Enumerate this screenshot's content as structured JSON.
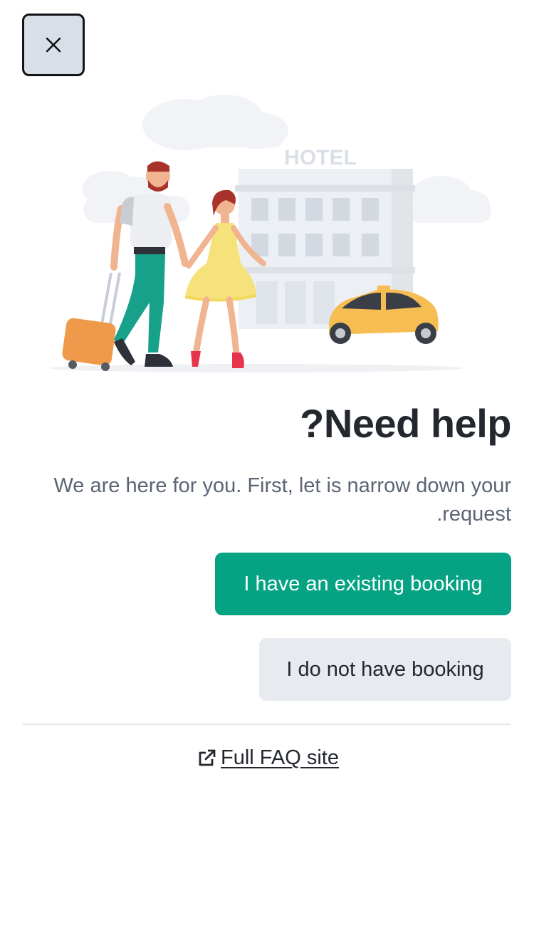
{
  "header": {
    "close_icon": "close-icon"
  },
  "illustration": {
    "hotel_sign": "HOTEL"
  },
  "content": {
    "title": "?Need help",
    "subtitle_line1": "We are here for you. First, let is narrow down your",
    "subtitle_line2": ".request"
  },
  "actions": {
    "existing_booking_label": "I have an existing booking",
    "no_booking_label": "I do not have booking"
  },
  "footer": {
    "faq_label": "Full FAQ site",
    "faq_icon": "external-link-icon"
  },
  "colors": {
    "primary": "#05a383",
    "secondary_bg": "#e7ebf0",
    "text_dark": "#23272e",
    "text_muted": "#5b6574",
    "close_bg": "#d8dfe7"
  }
}
